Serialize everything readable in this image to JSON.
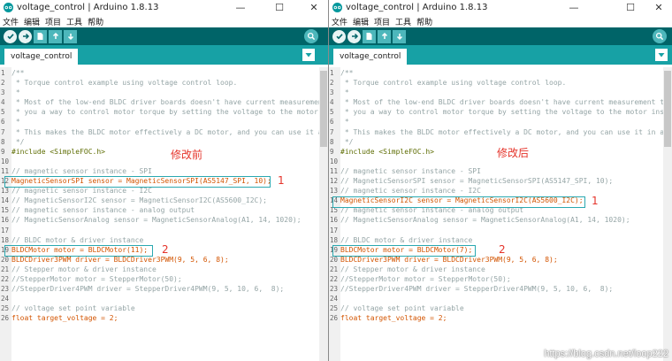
{
  "left": {
    "title": "voltage_control | Arduino 1.8.13",
    "menu": [
      "文件",
      "编辑",
      "项目",
      "工具",
      "帮助"
    ],
    "tab_label": "voltage_control",
    "annotation": "修改前",
    "lines": [
      {
        "n": "1",
        "t": "/**"
      },
      {
        "n": "2",
        "t": " * Torque control example using voltage control loop."
      },
      {
        "n": "3",
        "t": " *"
      },
      {
        "n": "4",
        "t": " * Most of the low-end BLDC driver boards doesn't have current measuremen"
      },
      {
        "n": "5",
        "t": " * you a way to control motor torque by setting the voltage to the motor"
      },
      {
        "n": "6",
        "t": " *"
      },
      {
        "n": "7",
        "t": " * This makes the BLDC motor effectively a DC motor, and you can use it a"
      },
      {
        "n": "8",
        "t": " */"
      },
      {
        "n": "9",
        "t": "#include <SimpleFOC.h>"
      },
      {
        "n": "10",
        "t": ""
      },
      {
        "n": "11",
        "t": "// magnetic sensor instance - SPI"
      },
      {
        "n": "12",
        "t": "MagneticSensorSPI sensor = MagneticSensorSPI(AS5147_SPI, 10);"
      },
      {
        "n": "13",
        "t": "// magnetic sensor instance - I2C"
      },
      {
        "n": "14",
        "t": "// MagneticSensorI2C sensor = MagneticSensorI2C(AS5600_I2C);"
      },
      {
        "n": "15",
        "t": "// magnetic sensor instance - analog output"
      },
      {
        "n": "16",
        "t": "// MagneticSensorAnalog sensor = MagneticSensorAnalog(A1, 14, 1020);"
      },
      {
        "n": "17",
        "t": ""
      },
      {
        "n": "18",
        "t": "// BLDC motor & driver instance"
      },
      {
        "n": "19",
        "t": "BLDCMotor motor = BLDCMotor(11);"
      },
      {
        "n": "20",
        "t": "BLDCDriver3PWM driver = BLDCDriver3PWM(9, 5, 6, 8);"
      },
      {
        "n": "21",
        "t": "// Stepper motor & driver instance"
      },
      {
        "n": "22",
        "t": "//StepperMotor motor = StepperMotor(50);"
      },
      {
        "n": "23",
        "t": "//StepperDriver4PWM driver = StepperDriver4PWM(9, 5, 10, 6,  8);"
      },
      {
        "n": "24",
        "t": ""
      },
      {
        "n": "25",
        "t": "// voltage set point variable"
      },
      {
        "n": "26",
        "t": "float target_voltage = 2;"
      }
    ],
    "markers": [
      "1",
      "2"
    ]
  },
  "right": {
    "title": "voltage_control | Arduino 1.8.13",
    "menu": [
      "文件",
      "编辑",
      "项目",
      "工具",
      "帮助"
    ],
    "tab_label": "voltage_control",
    "annotation": "修改后",
    "lines": [
      {
        "n": "1",
        "t": "/**"
      },
      {
        "n": "2",
        "t": " * Torque control example using voltage control loop."
      },
      {
        "n": "3",
        "t": " *"
      },
      {
        "n": "4",
        "t": " * Most of the low-end BLDC driver boards doesn't have current measurement th"
      },
      {
        "n": "5",
        "t": " * you a way to control motor torque by setting the voltage to the motor inst"
      },
      {
        "n": "6",
        "t": " *"
      },
      {
        "n": "7",
        "t": " * This makes the BLDC motor effectively a DC motor, and you can use it in a"
      },
      {
        "n": "8",
        "t": " */"
      },
      {
        "n": "9",
        "t": "#include <SimpleFOC.h>"
      },
      {
        "n": "10",
        "t": ""
      },
      {
        "n": "11",
        "t": "// magnetic sensor instance - SPI"
      },
      {
        "n": "12",
        "t": "// MagneticSensorSPI sensor = MagneticSensorSPI(AS5147_SPI, 10);"
      },
      {
        "n": "13",
        "t": "// magnetic sensor instance - I2C"
      },
      {
        "n": "14",
        "t": "MagneticSensorI2C sensor = MagneticSensorI2C(AS5600_I2C);"
      },
      {
        "n": "15",
        "t": "// magnetic sensor instance - analog output"
      },
      {
        "n": "16",
        "t": "// MagneticSensorAnalog sensor = MagneticSensorAnalog(A1, 14, 1020);"
      },
      {
        "n": "17",
        "t": ""
      },
      {
        "n": "18",
        "t": "// BLDC motor & driver instance"
      },
      {
        "n": "19",
        "t": "BLDCMotor motor = BLDCMotor(7);"
      },
      {
        "n": "20",
        "t": "BLDCDriver3PWM driver = BLDCDriver3PWM(9, 5, 6, 8);"
      },
      {
        "n": "21",
        "t": "// Stepper motor & driver instance"
      },
      {
        "n": "22",
        "t": "//StepperMotor motor = StepperMotor(50);"
      },
      {
        "n": "23",
        "t": "//StepperDriver4PWM driver = StepperDriver4PWM(9, 5, 10, 6,  8);"
      },
      {
        "n": "24",
        "t": ""
      },
      {
        "n": "25",
        "t": "// voltage set point variable"
      },
      {
        "n": "26",
        "t": "float target_voltage = 2;"
      }
    ],
    "markers": [
      "1",
      "2"
    ]
  },
  "watermark": "https://blog.csdn.net/loop222",
  "colors": {
    "toolbar": "#006468",
    "tabbar": "#17a1a5",
    "highlight_box": "#2aa8b0",
    "annotation": "#e5342b"
  }
}
